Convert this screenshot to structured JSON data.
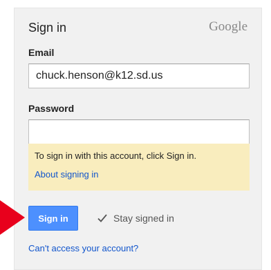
{
  "header": {
    "title": "Sign in",
    "brand": "Google"
  },
  "email": {
    "label": "Email",
    "value": "chuck.henson@k12.sd.us"
  },
  "password": {
    "label": "Password",
    "value": ""
  },
  "notice": {
    "text": "To sign in with this account, click Sign in.",
    "link": "About signing in"
  },
  "actions": {
    "signin_label": "Sign in",
    "stay_signed_in_label": "Stay signed in",
    "stay_signed_in_checked": true,
    "cant_access_label": "Can't access your account?"
  },
  "colors": {
    "card_background": "#f1f1f1",
    "notice_background": "#f9edbe",
    "button_blue": "#4d90fe",
    "link_blue": "#1155cc",
    "arrow_red": "#e8001c"
  },
  "icons": {
    "checkbox": "checkmark-icon",
    "pointer": "red-arrow-icon"
  }
}
